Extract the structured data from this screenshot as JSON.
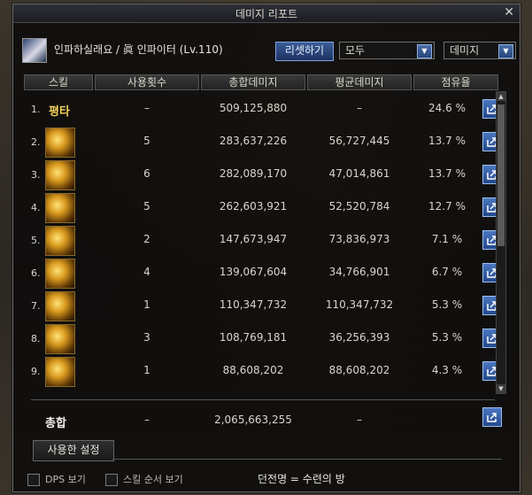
{
  "window": {
    "title": "데미지 리포트",
    "close_glyph": "✕"
  },
  "header": {
    "character_name": "인파하실래요 / 眞 인파이터 (Lv.110)",
    "reset_button": "리셋하기",
    "filter_select": "모두",
    "mode_select": "데미지"
  },
  "columns": [
    "스킬",
    "사용횟수",
    "총합데미지",
    "평균데미지",
    "점유율"
  ],
  "rows": [
    {
      "no": "1.",
      "skill": "평타",
      "uses": "–",
      "total": "509,125,880",
      "avg": "–",
      "share": "24.6 %"
    },
    {
      "no": "2.",
      "skill": "",
      "uses": "5",
      "total": "283,637,226",
      "avg": "56,727,445",
      "share": "13.7 %"
    },
    {
      "no": "3.",
      "skill": "",
      "uses": "6",
      "total": "282,089,170",
      "avg": "47,014,861",
      "share": "13.7 %"
    },
    {
      "no": "4.",
      "skill": "",
      "uses": "5",
      "total": "262,603,921",
      "avg": "52,520,784",
      "share": "12.7 %"
    },
    {
      "no": "5.",
      "skill": "",
      "uses": "2",
      "total": "147,673,947",
      "avg": "73,836,973",
      "share": "7.1 %"
    },
    {
      "no": "6.",
      "skill": "",
      "uses": "4",
      "total": "139,067,604",
      "avg": "34,766,901",
      "share": "6.7 %"
    },
    {
      "no": "7.",
      "skill": "",
      "uses": "1",
      "total": "110,347,732",
      "avg": "110,347,732",
      "share": "5.3 %"
    },
    {
      "no": "8.",
      "skill": "",
      "uses": "3",
      "total": "108,769,181",
      "avg": "36,256,393",
      "share": "5.3 %"
    },
    {
      "no": "9.",
      "skill": "",
      "uses": "1",
      "total": "88,608,202",
      "avg": "88,608,202",
      "share": "4.3 %"
    }
  ],
  "total": {
    "label": "총합",
    "uses": "–",
    "total": "2,065,663,255",
    "avg": "–"
  },
  "footer": {
    "used_settings_tab": "사용한 설정",
    "dps_view": "DPS 보기",
    "skill_order_view": "스킬 순서 보기",
    "dungeon": "던전명 = 수련의 방"
  },
  "colors": {
    "accent": "#3a5d9a",
    "skill_text": "#f2d05a"
  }
}
